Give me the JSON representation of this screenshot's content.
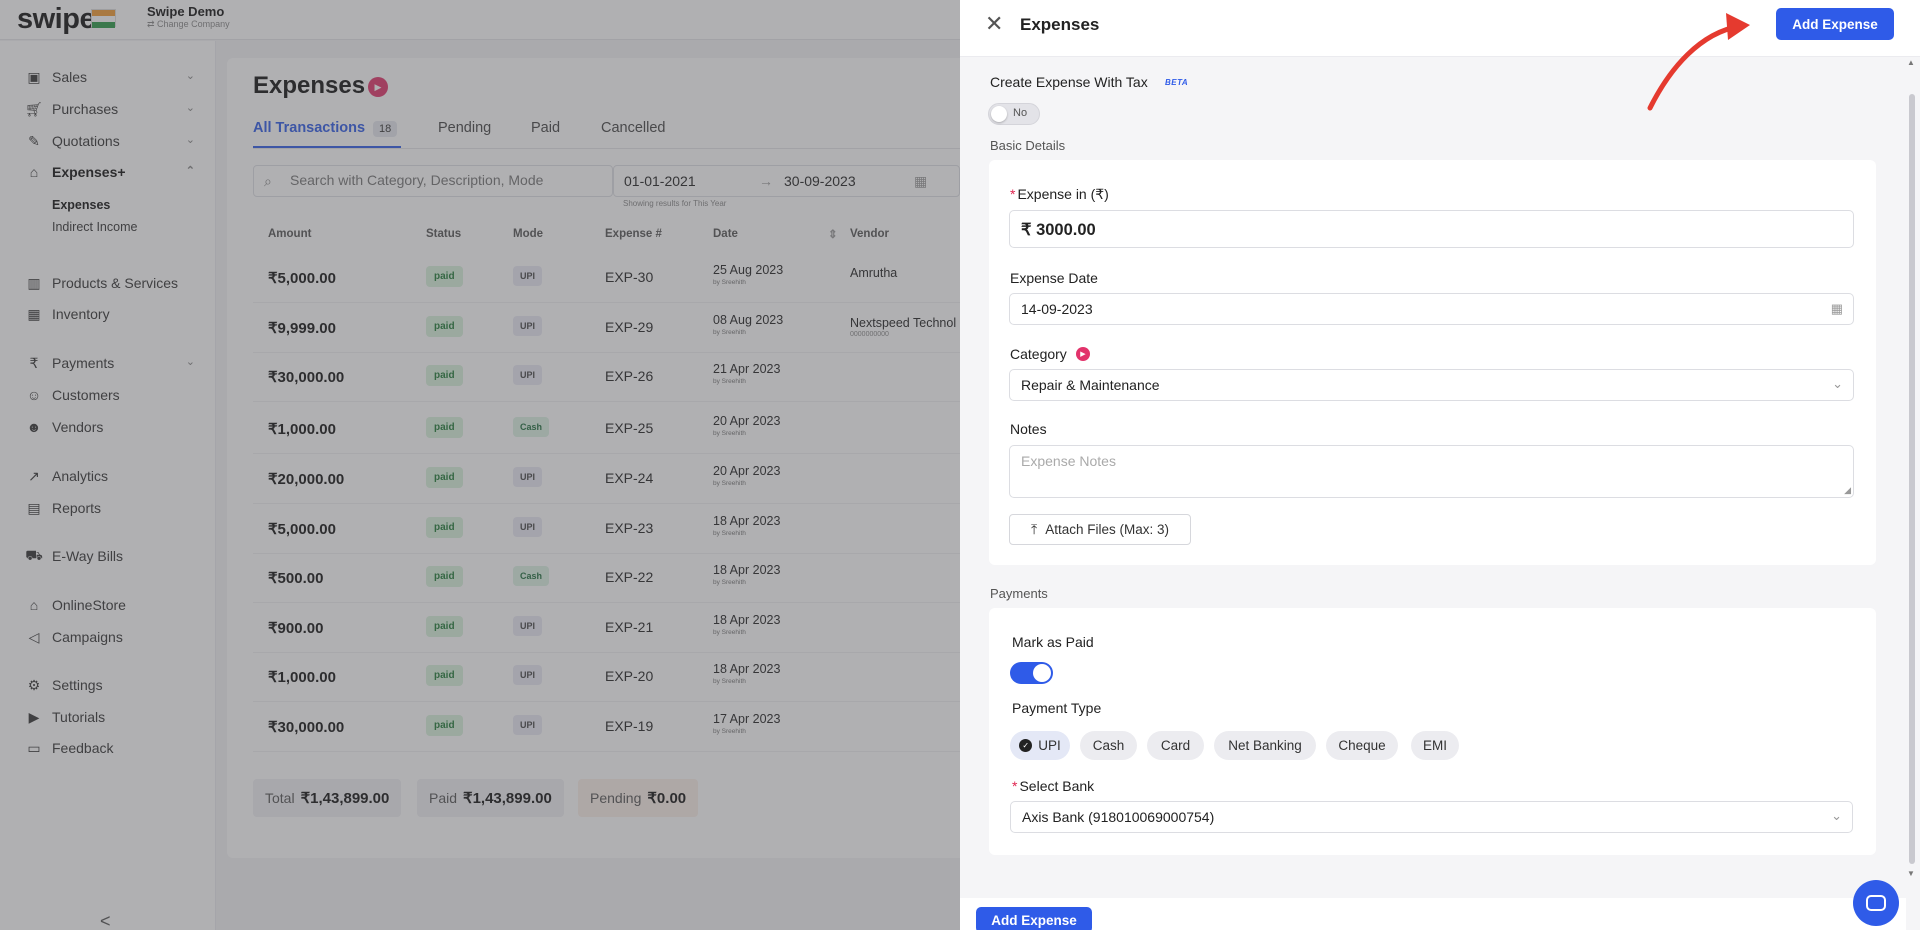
{
  "app": {
    "logo": "swipe",
    "company": "Swipe Demo",
    "company_sub": "⇄ Change Company"
  },
  "sidebar": {
    "items": [
      {
        "label": "Sales",
        "icon": "sales-icon"
      },
      {
        "label": "Purchases",
        "icon": "cart-icon"
      },
      {
        "label": "Quotations",
        "icon": "pen-icon"
      },
      {
        "label": "Expenses+",
        "icon": "tag-icon"
      },
      {
        "label": "Products & Services",
        "icon": "barcode-icon"
      },
      {
        "label": "Inventory",
        "icon": "inventory-icon"
      },
      {
        "label": "Payments",
        "icon": "rupee-icon"
      },
      {
        "label": "Customers",
        "icon": "user-icon"
      },
      {
        "label": "Vendors",
        "icon": "users-icon"
      },
      {
        "label": "Analytics",
        "icon": "chart-icon"
      },
      {
        "label": "Reports",
        "icon": "report-icon"
      },
      {
        "label": "E-Way Bills",
        "icon": "truck-icon"
      },
      {
        "label": "OnlineStore",
        "icon": "store-icon"
      },
      {
        "label": "Campaigns",
        "icon": "megaphone-icon"
      },
      {
        "label": "Settings",
        "icon": "gear-icon"
      },
      {
        "label": "Tutorials",
        "icon": "youtube-icon"
      },
      {
        "label": "Feedback",
        "icon": "feedback-icon"
      }
    ],
    "sub_items": [
      "Expenses",
      "Indirect Income"
    ],
    "collapse": "<"
  },
  "list": {
    "title": "Expenses",
    "tabs": [
      {
        "label": "All Transactions",
        "count": "18"
      },
      {
        "label": "Pending"
      },
      {
        "label": "Paid"
      },
      {
        "label": "Cancelled"
      }
    ],
    "search_placeholder": "Search with Category, Description, Mode",
    "date_from": "01-01-2021",
    "date_arrow": "→",
    "date_to": "30-09-2023",
    "date_hint": "Showing results for This Year",
    "columns": [
      "Amount",
      "Status",
      "Mode",
      "Expense #",
      "Date",
      "Vendor"
    ],
    "rows": [
      {
        "amount": "₹5,000.00",
        "status": "paid",
        "mode": "UPI",
        "exp": "EXP-30",
        "date": "25 Aug 2023",
        "by": "by Sreehith",
        "vendor": "Amrutha",
        "vendor_sub": ""
      },
      {
        "amount": "₹9,999.00",
        "status": "paid",
        "mode": "UPI",
        "exp": "EXP-29",
        "date": "08 Aug 2023",
        "by": "by Sreehith",
        "vendor": "Nextspeed Technol",
        "vendor_sub": "0000000000"
      },
      {
        "amount": "₹30,000.00",
        "status": "paid",
        "mode": "UPI",
        "exp": "EXP-26",
        "date": "21 Apr 2023",
        "by": "by Sreehith",
        "vendor": "",
        "vendor_sub": ""
      },
      {
        "amount": "₹1,000.00",
        "status": "paid",
        "mode": "Cash",
        "exp": "EXP-25",
        "date": "20 Apr 2023",
        "by": "by Sreehith",
        "vendor": "",
        "vendor_sub": ""
      },
      {
        "amount": "₹20,000.00",
        "status": "paid",
        "mode": "UPI",
        "exp": "EXP-24",
        "date": "20 Apr 2023",
        "by": "by Sreehith",
        "vendor": "",
        "vendor_sub": ""
      },
      {
        "amount": "₹5,000.00",
        "status": "paid",
        "mode": "UPI",
        "exp": "EXP-23",
        "date": "18 Apr 2023",
        "by": "by Sreehith",
        "vendor": "",
        "vendor_sub": ""
      },
      {
        "amount": "₹500.00",
        "status": "paid",
        "mode": "Cash",
        "exp": "EXP-22",
        "date": "18 Apr 2023",
        "by": "by Sreehith",
        "vendor": "",
        "vendor_sub": ""
      },
      {
        "amount": "₹900.00",
        "status": "paid",
        "mode": "UPI",
        "exp": "EXP-21",
        "date": "18 Apr 2023",
        "by": "by Sreehith",
        "vendor": "",
        "vendor_sub": ""
      },
      {
        "amount": "₹1,000.00",
        "status": "paid",
        "mode": "UPI",
        "exp": "EXP-20",
        "date": "18 Apr 2023",
        "by": "by Sreehith",
        "vendor": "",
        "vendor_sub": ""
      },
      {
        "amount": "₹30,000.00",
        "status": "paid",
        "mode": "UPI",
        "exp": "EXP-19",
        "date": "17 Apr 2023",
        "by": "by Sreehith",
        "vendor": "",
        "vendor_sub": ""
      }
    ],
    "summary": {
      "total_label": "Total",
      "total": "₹1,43,899.00",
      "paid_label": "Paid",
      "paid": "₹1,43,899.00",
      "pending_label": "Pending",
      "pending": "₹0.00"
    }
  },
  "drawer": {
    "title": "Expenses",
    "add_button": "Add Expense",
    "with_tax_label": "Create Expense With Tax",
    "beta": "BETA",
    "tax_toggle": "No",
    "basic_details": "Basic Details",
    "expense_label": "Expense in (₹)",
    "expense_value": "₹  3000.00",
    "date_label": "Expense Date",
    "date_value": "14-09-2023",
    "category_label": "Category",
    "category_value": "Repair & Maintenance",
    "notes_label": "Notes",
    "notes_placeholder": "Expense Notes",
    "attach": "Attach Files (Max: 3)",
    "payments_title": "Payments",
    "mark_paid_label": "Mark as Paid",
    "mark_paid": true,
    "payment_type_label": "Payment Type",
    "payment_types": [
      "UPI",
      "Cash",
      "Card",
      "Net Banking",
      "Cheque",
      "EMI"
    ],
    "selected_payment_type": "UPI",
    "bank_label": "Select Bank",
    "bank_value": "Axis Bank (918010069000754)",
    "footer_button": "Add Expense"
  },
  "colors": {
    "accent": "#2f5be8",
    "brand_pink": "#e2336b",
    "paid_green": "#1f7a36",
    "annotation_arrow": "#e53a2f"
  }
}
